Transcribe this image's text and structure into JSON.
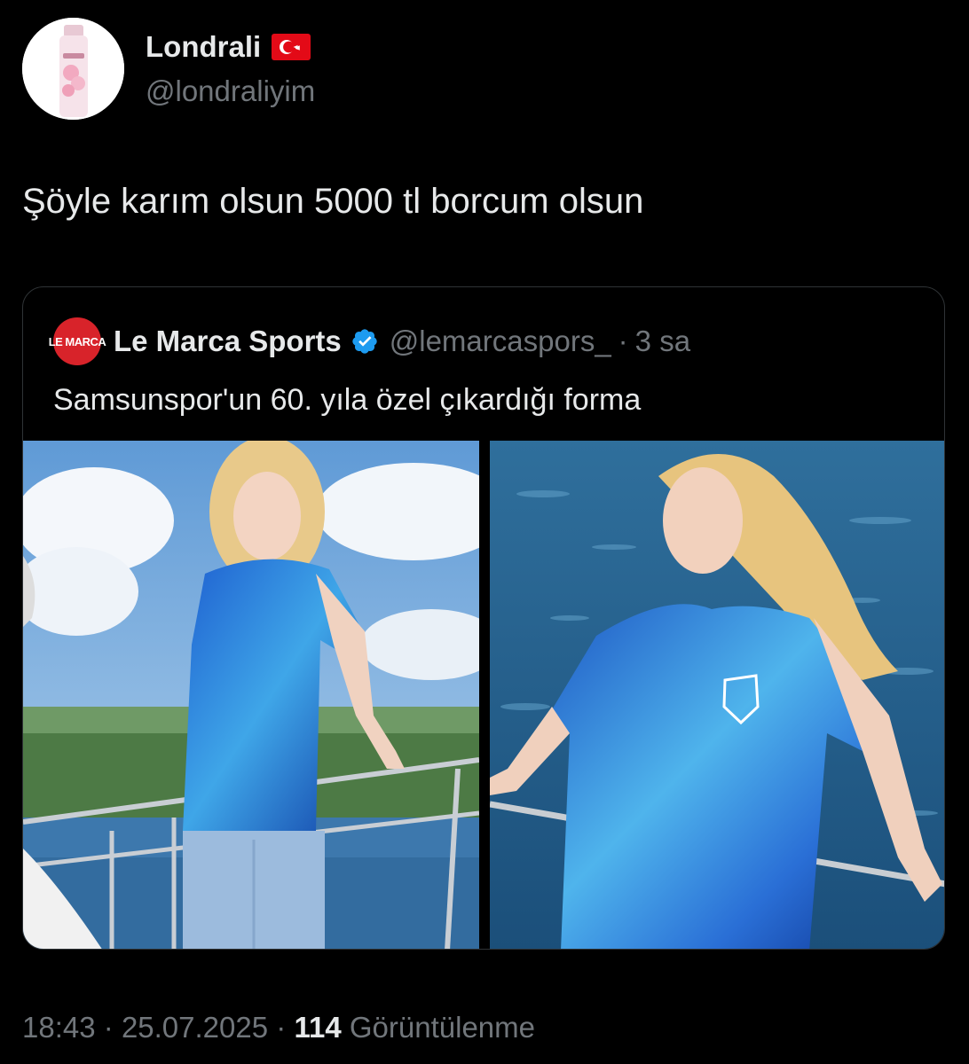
{
  "author": {
    "name": "Londrali",
    "flag": "🇹🇷",
    "handle": "@londraliyim",
    "avatar_icon": "perfume-bottle-icon"
  },
  "tweet": {
    "text": "Şöyle karım olsun 5000 tl borcum olsun"
  },
  "quote": {
    "logo_text": "LE MARCA",
    "name": "Le Marca Sports",
    "verified_icon": "verified-badge-icon",
    "handle": "@lemarcaspors_",
    "separator": "·",
    "time": "3 sa",
    "text": "Samsunspor'un 60. yıla özel çıkardığı forma",
    "photos": [
      {
        "alt_icon": "photo-woman-jersey-sky"
      },
      {
        "alt_icon": "photo-woman-jersey-sea"
      }
    ]
  },
  "meta": {
    "time": "18:43",
    "sep1": "·",
    "date": "25.07.2025",
    "sep2": "·",
    "views_count": "114",
    "views_label": "Görüntülenme"
  },
  "colors": {
    "background": "#000000",
    "primary_text": "#e7e9ea",
    "secondary_text": "#71767b",
    "border": "#2f3336",
    "verified": "#1d9bf0",
    "logo_red": "#d8232a"
  }
}
